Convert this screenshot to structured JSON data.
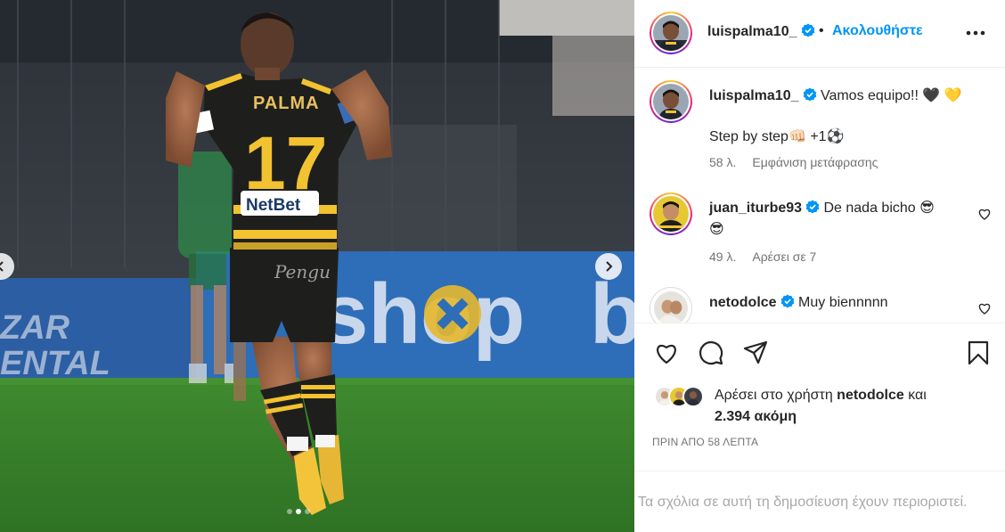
{
  "post": {
    "username": "luispalma10_",
    "separator": "•",
    "follow_label": "Ακολουθήστε",
    "more_icon": "more-horizontal-icon"
  },
  "photo": {
    "jersey_name": "PALMA",
    "jersey_number": "17",
    "sponsor": "NetBet",
    "shorts_logo": "Pengu",
    "board_left_line1": "ZAR",
    "board_left_line2": "ENTAL",
    "board_main": "shop",
    "board_right": "b",
    "carousel": {
      "count": 3,
      "active_index": 1
    }
  },
  "caption": {
    "username": "luispalma10_",
    "text_line1": "Vamos equipo!! 🖤 💛",
    "text_line2": "Step by step👊🏻 +1⚽",
    "age": "58 λ.",
    "translate_label": "Εμφάνιση μετάφρασης"
  },
  "comments": [
    {
      "username": "juan_iturbe93",
      "text_line1": "De nada bicho 😎",
      "text_line2": "😎",
      "age": "49 λ.",
      "likes_label": "Αρέσει σε 7"
    },
    {
      "username": "netodolce",
      "text_line1": "Muy biennnnn"
    }
  ],
  "actions": {
    "like_icon": "heart-icon",
    "comment_icon": "comment-icon",
    "share_icon": "send-icon",
    "save_icon": "bookmark-icon"
  },
  "likes": {
    "prefix": "Αρέσει στο χρήστη",
    "liker": "netodolce",
    "suffix": "και",
    "count_text": "2.394 ακόμη"
  },
  "timestamp": "ΠΡΙΝ ΑΠΟ 58 ΛΕΠΤΑ",
  "comments_restricted": "Τα σχόλια σε αυτή τη δημοσίευση έχουν περιοριστεί.",
  "colors": {
    "link_blue": "#0095f6",
    "verified_blue": "#0095f6",
    "jersey_yellow": "#f2c230",
    "jersey_black": "#1e1f1c"
  }
}
